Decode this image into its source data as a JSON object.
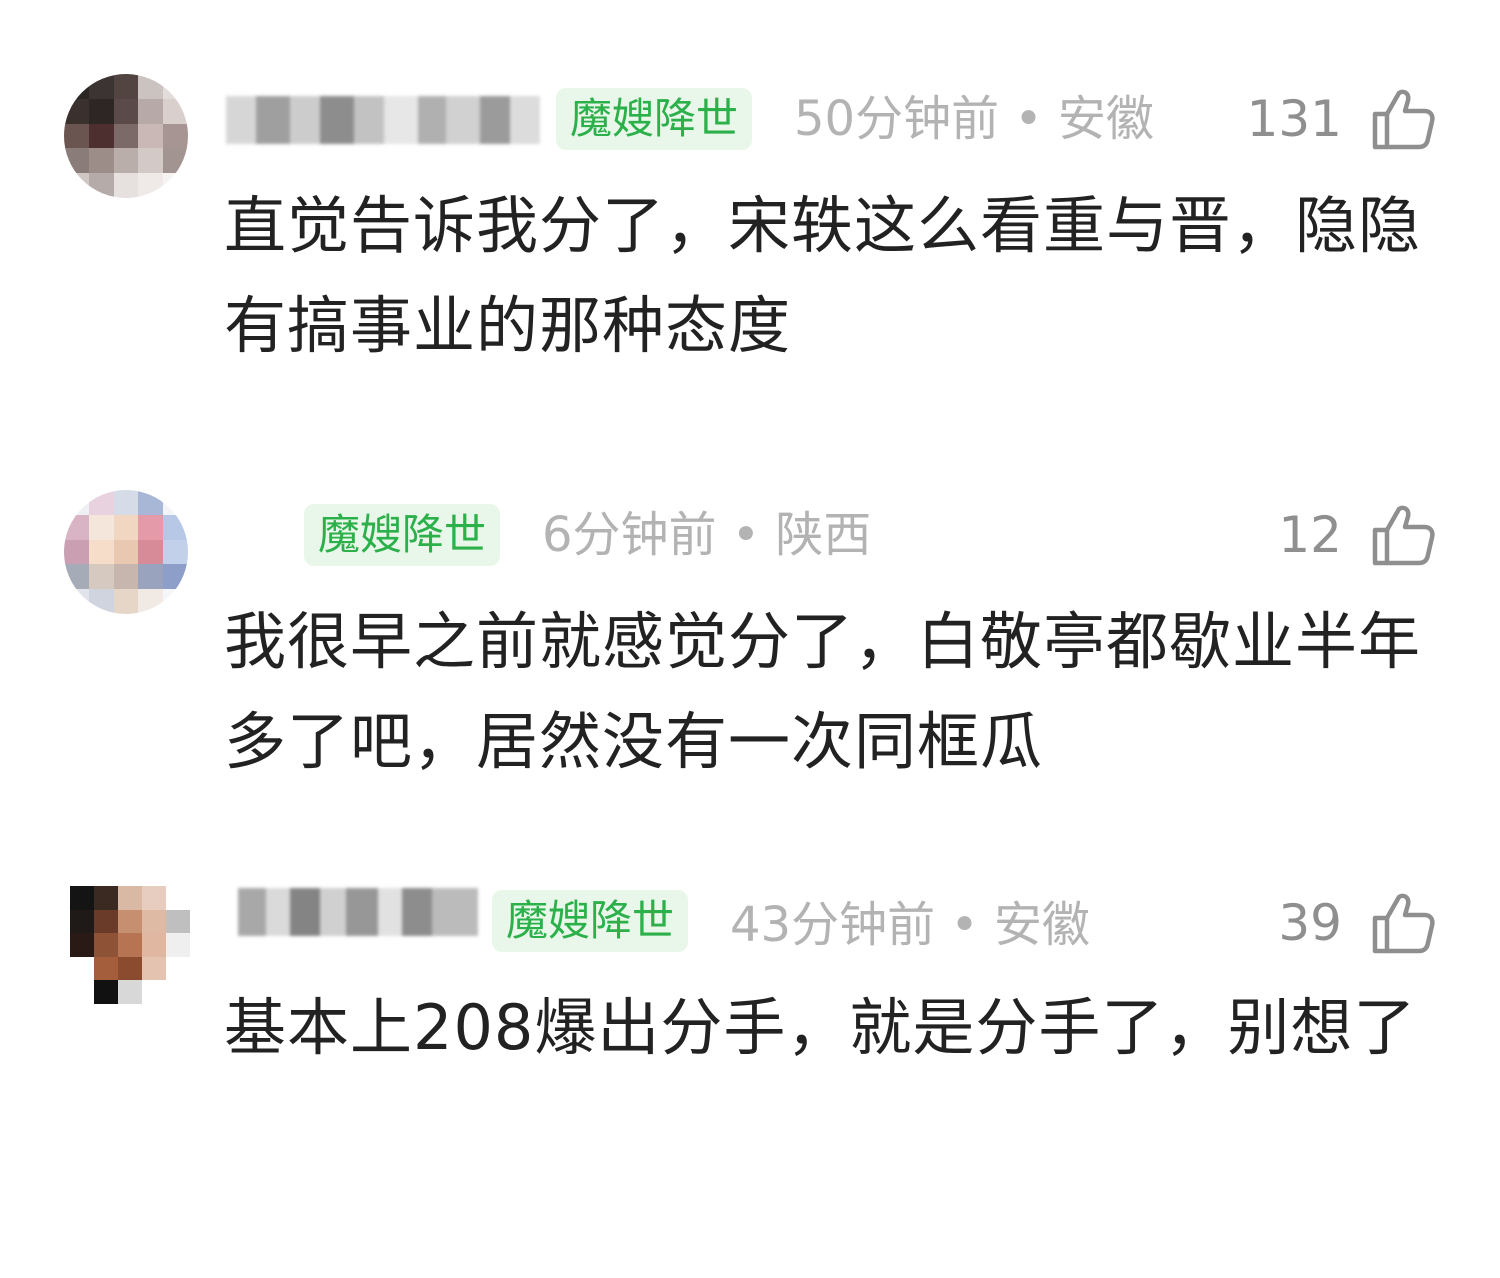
{
  "comments": [
    {
      "badge": "魔嫂降世",
      "meta": "50分钟前 • 安徽",
      "likes": "131",
      "content": "直觉告诉我分了，宋轶这么看重与晋，隐隐有搞事业的那种态度"
    },
    {
      "badge": "魔嫂降世",
      "meta": "6分钟前 • 陕西",
      "likes": "12",
      "content": "我很早之前就感觉分了，白敬亭都歇业半年多了吧，居然没有一次同框瓜"
    },
    {
      "badge": "魔嫂降世",
      "meta": "43分钟前 • 安徽",
      "likes": "39",
      "content": "基本上208爆出分手，就是分手了，别想了"
    }
  ],
  "icons": {
    "like": "thumbs-up-icon"
  },
  "colors": {
    "badge_text": "#2bb04a",
    "badge_bg": "#e9f7ea",
    "meta": "#b3b3b3",
    "likes": "#8f8f8f",
    "content": "#222222"
  }
}
